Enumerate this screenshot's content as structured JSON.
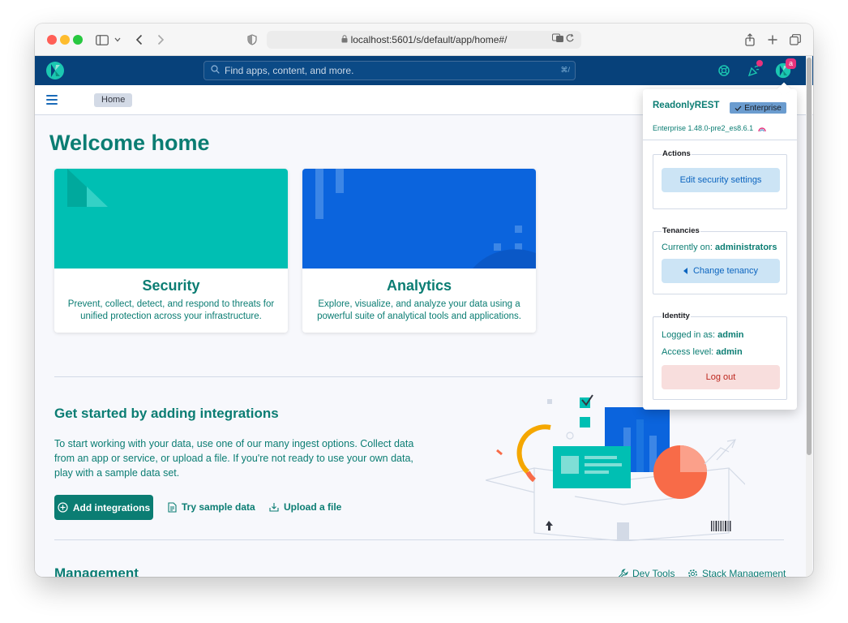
{
  "browser": {
    "url": "localhost:5601/s/default/app/home#/"
  },
  "header": {
    "search_placeholder": "Find apps, content, and more.",
    "search_shortcut": "⌘/",
    "avatar_initial": "a"
  },
  "breadcrumb": {
    "home": "Home"
  },
  "main": {
    "welcome_title": "Welcome home",
    "cards": [
      {
        "title": "Security",
        "description": "Prevent, collect, detect, and respond to threats for unified protection across your infrastructure.",
        "color": "#00bfb3"
      },
      {
        "title": "Analytics",
        "description": "Explore, visualize, and analyze your data using a powerful suite of analytical tools and applications.",
        "color": "#0b64dd"
      }
    ],
    "get_started": {
      "title": "Get started by adding integrations",
      "description": "To start working with your data, use one of our many ingest options. Collect data from an app or service, or upload a file. If you're not ready to use your own data, play with a sample data set.",
      "add_integrations": "Add integrations",
      "try_sample": "Try sample data",
      "upload_file": "Upload a file"
    },
    "management": {
      "title": "Management",
      "dev_tools": "Dev Tools",
      "stack_management": "Stack Management"
    }
  },
  "popover": {
    "username": "ReadonlyREST",
    "edition_badge": "Enterprise",
    "version": "Enterprise 1.48.0-pre2_es8.6.1",
    "actions": {
      "title": "Actions",
      "edit_security": "Edit security settings"
    },
    "tenancies": {
      "title": "Tenancies",
      "current_label": "Currently on:",
      "current_value": "administrators",
      "change_button": "Change tenancy"
    },
    "identity": {
      "title": "Identity",
      "logged_label": "Logged in as:",
      "logged_value": "admin",
      "access_label": "Access level:",
      "access_value": "admin",
      "logout": "Log out"
    }
  },
  "colors": {
    "accent": "#0b7d73",
    "header": "#07417a",
    "danger": "#bd271e"
  }
}
